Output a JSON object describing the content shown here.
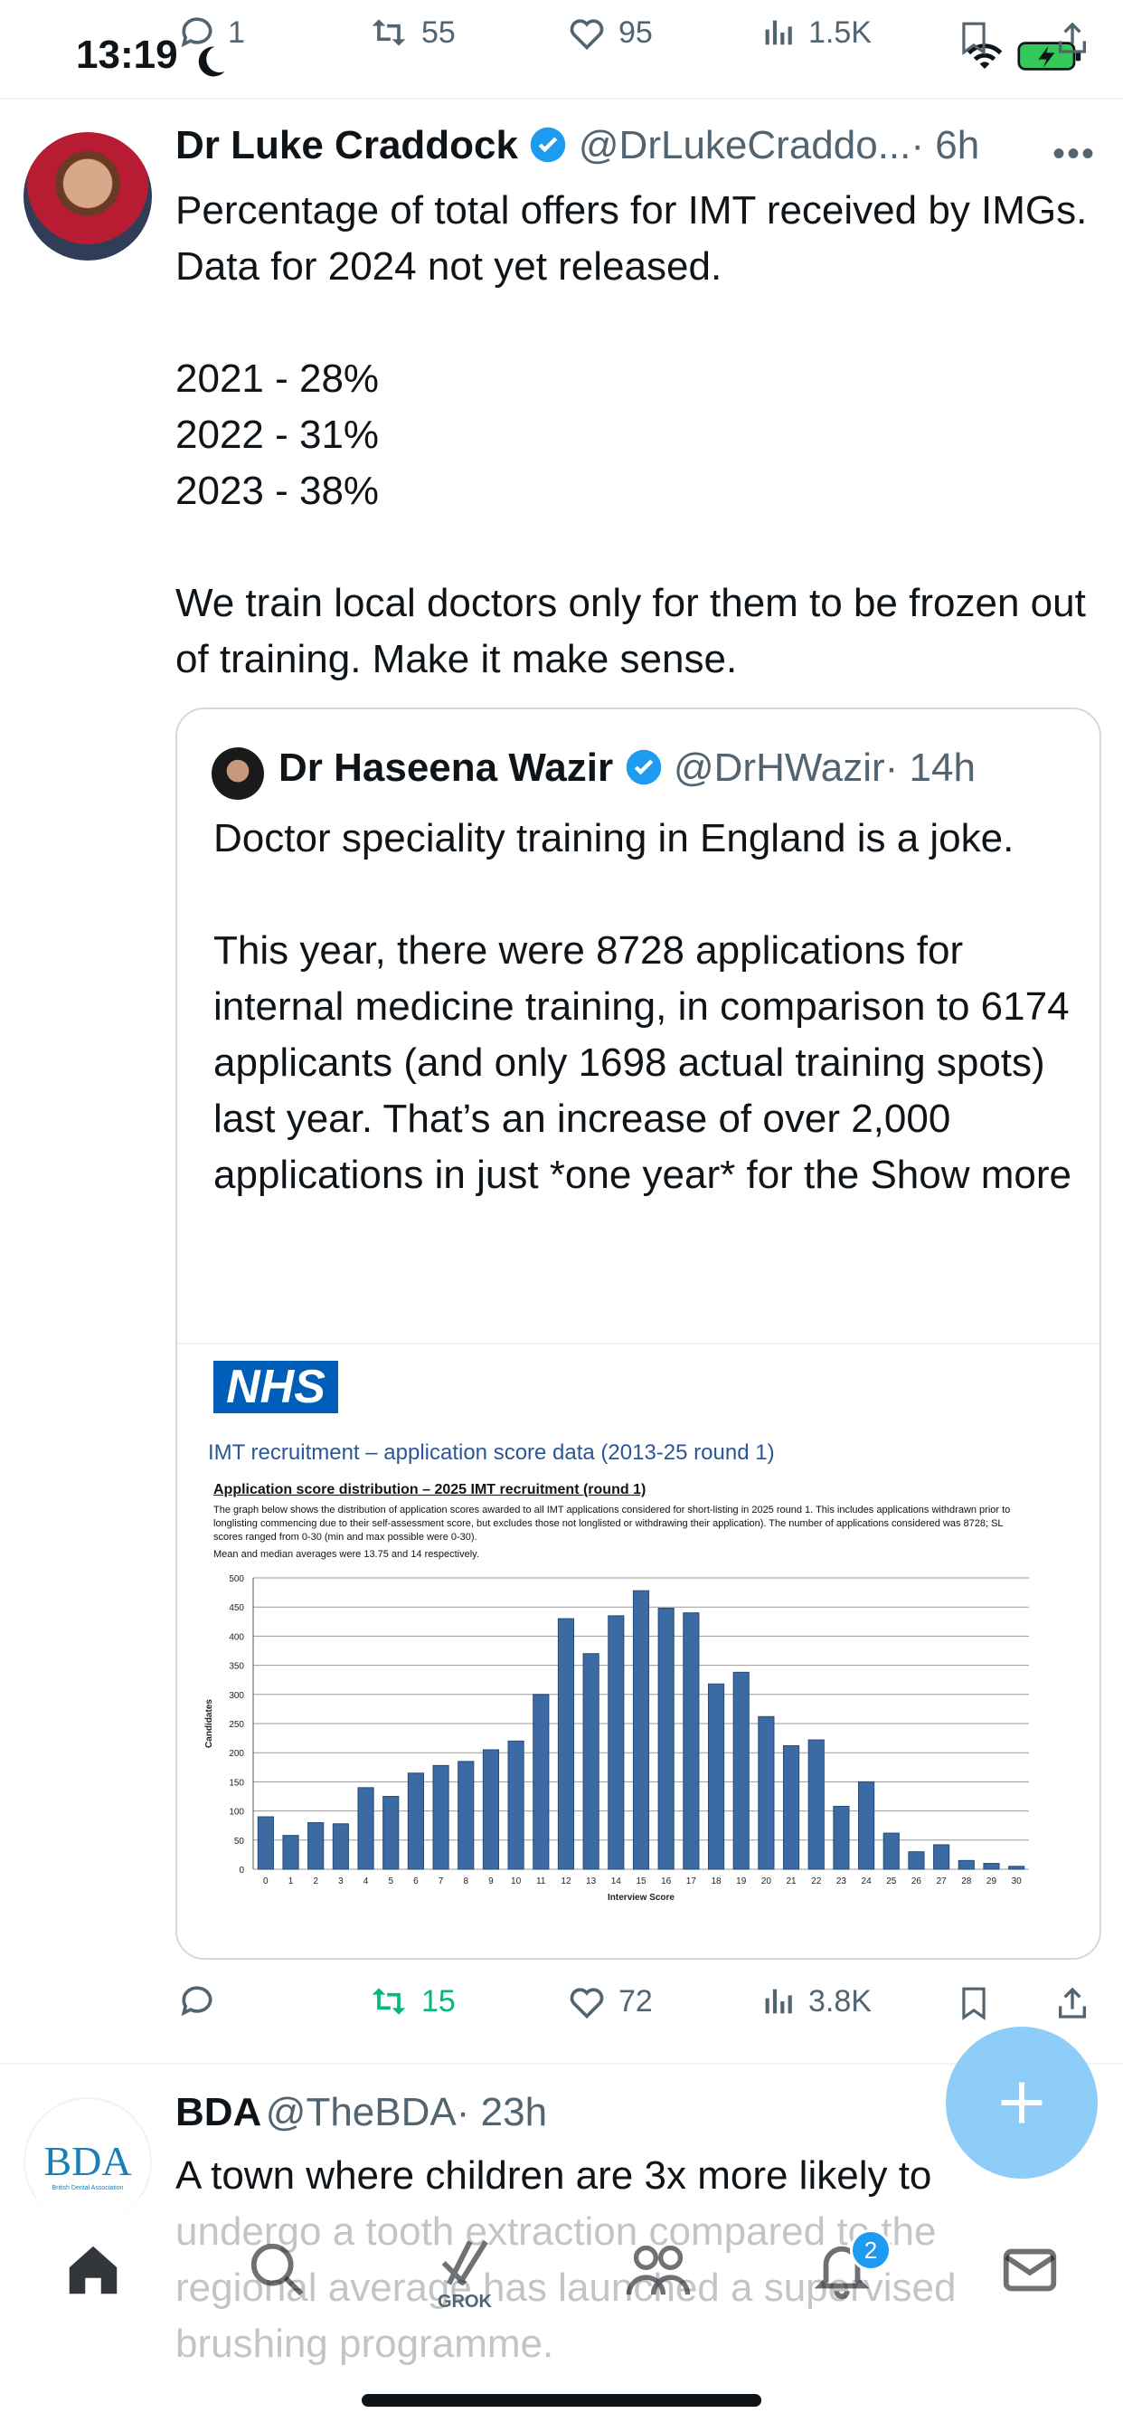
{
  "status": {
    "time": "13:19"
  },
  "prev_tweet_actions": {
    "replies": "1",
    "retweets": "55",
    "likes": "95",
    "views": "1.5K"
  },
  "tweet": {
    "author_name": "Dr Luke Craddock",
    "author_handle": "@DrLukeCraddo...",
    "time": "· 6h",
    "text": "Percentage of total offers for IMT received by IMGs. Data for 2024 not yet released.\n\n2021 - 28%\n2022 - 31%\n2023 - 38%\n\nWe train local doctors only for them to be frozen out of training. Make it make sense.",
    "actions": {
      "retweets": "15",
      "likes": "72",
      "views": "3.8K"
    }
  },
  "quote": {
    "author_name": "Dr Haseena Wazir",
    "author_handle": "@DrHWazir",
    "time": "· 14h",
    "text": "Doctor speciality training in England is a joke.\n\nThis year, there were 8728 applications for internal medicine training, in comparison to 6174 applicants (and only 1698 actual training spots) last year. That’s an increase of over 2,000 applications in just *one year* for the",
    "show_more": "Show more",
    "media": {
      "logo": "NHS",
      "header": "IMT recruitment – application score data (2013-25 round 1)",
      "section_title": "Application score distribution – 2025 IMT recruitment (round 1)",
      "para1": "The graph below shows the distribution of application scores awarded to all IMT applications considered for short-listing in 2025 round 1. This includes applications withdrawn prior to longlisting commencing due to their self-assessment score, but excludes those not longlisted or withdrawing their application). The number of applications considered was 8728; SL scores ranged from 0-30 (min and max possible were 0-30).",
      "para2": "Mean and median averages were 13.75 and 14 respectively."
    }
  },
  "chart_data": {
    "type": "bar",
    "xlabel": "Interview Score",
    "ylabel": "Candidates",
    "ylim": [
      0,
      500
    ],
    "yticks": [
      0,
      50,
      100,
      150,
      200,
      250,
      300,
      350,
      400,
      450,
      500
    ],
    "categories": [
      "0",
      "1",
      "2",
      "3",
      "4",
      "5",
      "6",
      "7",
      "8",
      "9",
      "10",
      "11",
      "12",
      "13",
      "14",
      "15",
      "16",
      "17",
      "18",
      "19",
      "20",
      "21",
      "22",
      "23",
      "24",
      "25",
      "26",
      "27",
      "28",
      "29",
      "30"
    ],
    "values": [
      90,
      58,
      80,
      78,
      140,
      125,
      165,
      178,
      185,
      205,
      220,
      300,
      430,
      370,
      435,
      478,
      448,
      440,
      318,
      338,
      262,
      212,
      222,
      108,
      150,
      62,
      30,
      42,
      15,
      10,
      5
    ],
    "bar_color": "#3c6aa3",
    "grid": true
  },
  "next_tweet": {
    "author_name": "BDA",
    "author_handle": "@TheBDA",
    "time": "· 23h",
    "avatar_text": "BDA",
    "avatar_sub": "British Dental Association",
    "text": "A town where children are 3x more likely to undergo a tooth extraction compared to the regional average has launched a supervised brushing programme."
  },
  "nav": {
    "grok_label": "GROK",
    "notifications_badge": "2"
  },
  "colors": {
    "accent": "#1d9bf0",
    "retweet_green": "#00ba7c",
    "muted": "#536471"
  }
}
